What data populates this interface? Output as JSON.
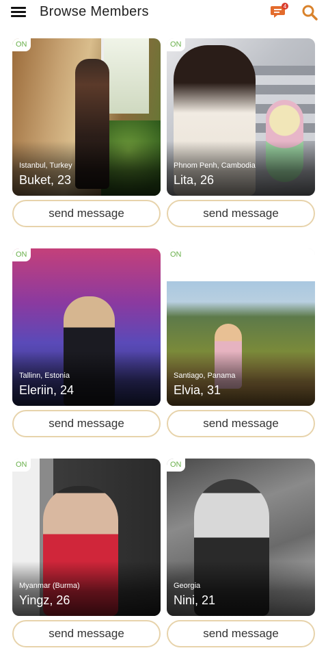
{
  "header": {
    "title": "Browse Members",
    "notification_count": "4",
    "icons": [
      "menu-icon",
      "chat-notification-icon",
      "search-icon"
    ]
  },
  "members": [
    {
      "online": "ON",
      "location": "Istanbul, Turkey",
      "name": "Buket, 23",
      "button": "send message"
    },
    {
      "online": "ON",
      "location": "Phnom Penh, Cambodia",
      "name": "Lita, 26",
      "button": "send message"
    },
    {
      "online": "ON",
      "location": "Tallinn, Estonia",
      "name": "Eleriin, 24",
      "button": "send message"
    },
    {
      "online": "ON",
      "location": "Santiago, Panama",
      "name": "Elvia, 31",
      "button": "send message"
    },
    {
      "online": "ON",
      "location": "Myanmar (Burma)",
      "name": "Yingz, 26",
      "button": "send message"
    },
    {
      "online": "ON",
      "location": "Georgia",
      "name": "Nini, 21",
      "button": "send message"
    }
  ],
  "colors": {
    "online_text": "#6ab04c",
    "button_border": "#e7d3ab",
    "chat_icon": "#e36b2c",
    "notification_badge": "#d93a2b",
    "search_icon": "#d9822b"
  }
}
